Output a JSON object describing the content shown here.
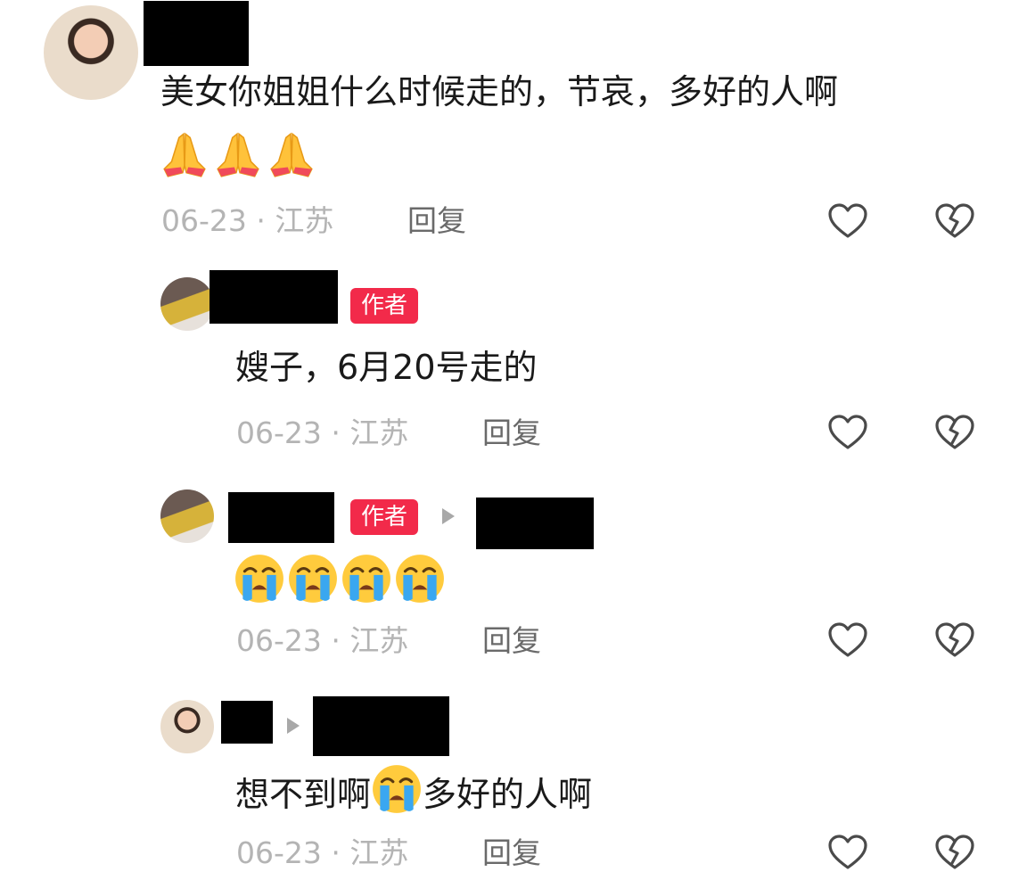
{
  "comments": [
    {
      "text": "美女你姐姐什么时候走的，节哀，多好的人啊",
      "emoji": [
        "folded-hands",
        "folded-hands",
        "folded-hands"
      ],
      "date": "06-23",
      "sep": "·",
      "location": "江苏",
      "reply": "回复"
    },
    {
      "badge": "作者",
      "text": "嫂子，6月20号走的",
      "date": "06-23",
      "sep": "·",
      "location": "江苏",
      "reply": "回复"
    },
    {
      "badge": "作者",
      "emoji": [
        "loudly-crying-face",
        "loudly-crying-face",
        "loudly-crying-face",
        "loudly-crying-face"
      ],
      "date": "06-23",
      "sep": "·",
      "location": "江苏",
      "reply": "回复"
    },
    {
      "text_before": "想不到啊",
      "emoji": [
        "loudly-crying-face"
      ],
      "text_after": "多好的人啊",
      "date": "06-23",
      "sep": "·",
      "location": "江苏",
      "reply": "回复"
    }
  ],
  "icons": {
    "like": "heart-outline-icon",
    "dislike": "broken-heart-icon",
    "reply_arrow": "triangle-right-icon"
  },
  "colors": {
    "author_badge": "#f22a4a",
    "meta_text": "#b4b4b4",
    "reply_text": "#6a6a6a",
    "icon_stroke": "#4a4a4a"
  }
}
